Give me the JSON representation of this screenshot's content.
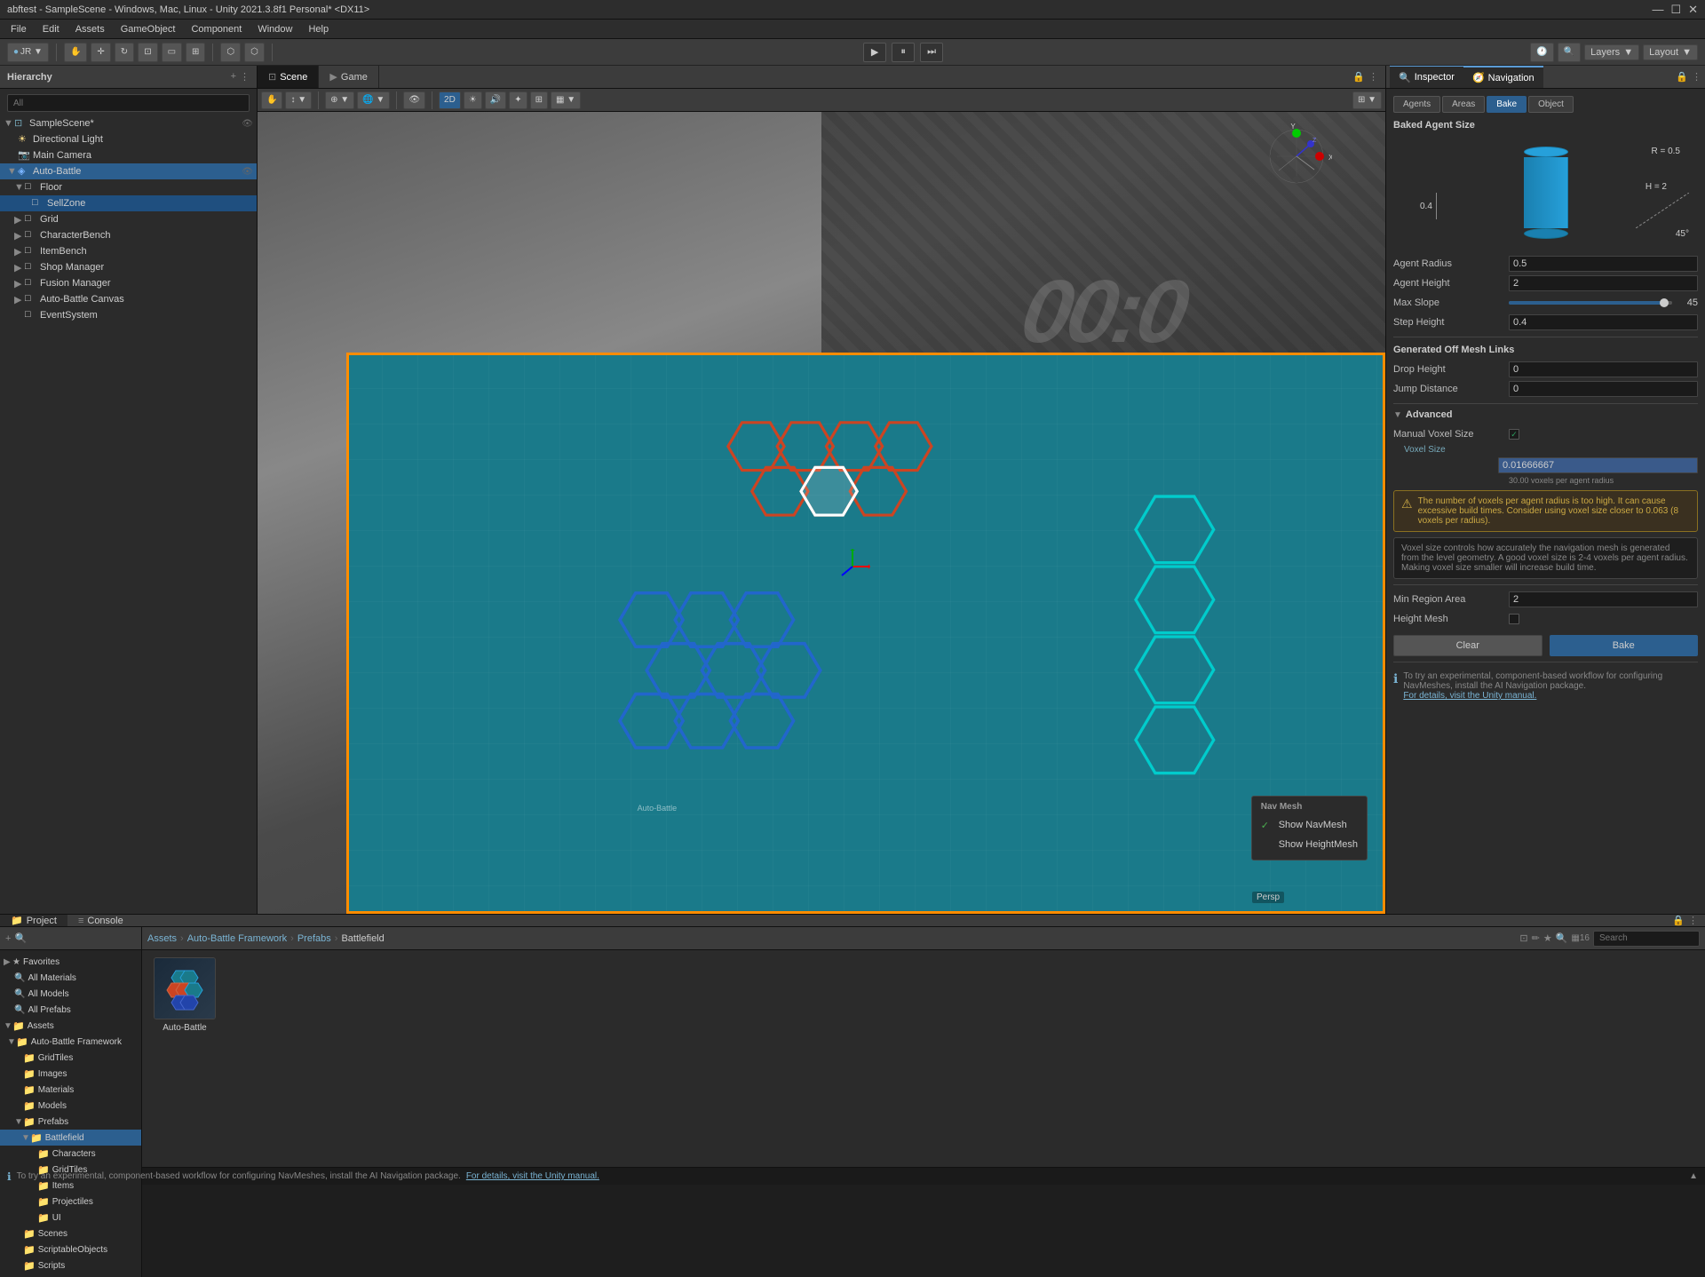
{
  "titlebar": {
    "title": "abftest - SampleScene - Windows, Mac, Linux - Unity 2021.3.8f1 Personal* <DX11>",
    "controls": [
      "—",
      "☐",
      "✕"
    ]
  },
  "menubar": {
    "items": [
      "File",
      "Edit",
      "Assets",
      "GameObject",
      "Component",
      "Window",
      "Help"
    ]
  },
  "toolbar": {
    "account": "JR ▼",
    "layers_label": "Layers",
    "layout_label": "Layout"
  },
  "hierarchy": {
    "title": "Hierarchy",
    "search_placeholder": "All",
    "items": [
      {
        "label": "SampleScene*",
        "indent": 0,
        "type": "scene",
        "arrow": "▼"
      },
      {
        "label": "Directional Light",
        "indent": 1,
        "type": "light",
        "arrow": ""
      },
      {
        "label": "Main Camera",
        "indent": 1,
        "type": "camera",
        "arrow": ""
      },
      {
        "label": "Auto-Battle",
        "indent": 1,
        "type": "prefab",
        "arrow": "▼",
        "selected": true
      },
      {
        "label": "Floor",
        "indent": 2,
        "type": "object",
        "arrow": "▼"
      },
      {
        "label": "SellZone",
        "indent": 3,
        "type": "object",
        "arrow": "",
        "highlighted": true
      },
      {
        "label": "Grid",
        "indent": 2,
        "type": "object",
        "arrow": "▶"
      },
      {
        "label": "CharacterBench",
        "indent": 2,
        "type": "object",
        "arrow": "▶"
      },
      {
        "label": "ItemBench",
        "indent": 2,
        "type": "object",
        "arrow": "▶"
      },
      {
        "label": "Shop Manager",
        "indent": 2,
        "type": "object",
        "arrow": "▶"
      },
      {
        "label": "Fusion Manager",
        "indent": 2,
        "type": "object",
        "arrow": "▶"
      },
      {
        "label": "Auto-Battle Canvas",
        "indent": 2,
        "type": "object",
        "arrow": "▶"
      },
      {
        "label": "EventSystem",
        "indent": 2,
        "type": "object",
        "arrow": ""
      }
    ]
  },
  "scene": {
    "tabs": [
      "Scene",
      "Game"
    ],
    "active_tab": "Scene"
  },
  "inspector": {
    "tab_inspector": "Inspector",
    "tab_navigation": "Navigation",
    "sub_tabs": [
      "Agents",
      "Areas",
      "Bake",
      "Object"
    ],
    "active_sub_tab": "Bake",
    "section_baked_agent": "Baked Agent Size",
    "agent_r_label": "R = 0.5",
    "agent_h_label": "H = 2",
    "agent_angle_label": "45°",
    "agent_left_val": "0.4",
    "rows": [
      {
        "label": "Agent Radius",
        "value": "0.5"
      },
      {
        "label": "Agent Height",
        "value": "2"
      },
      {
        "label": "Max Slope",
        "value": "45",
        "has_slider": true,
        "slider_pct": 95
      },
      {
        "label": "Step Height",
        "value": "0.4"
      }
    ],
    "section_off_mesh": "Generated Off Mesh Links",
    "off_mesh_rows": [
      {
        "label": "Drop Height",
        "value": "0"
      },
      {
        "label": "Jump Distance",
        "value": "0"
      }
    ],
    "section_advanced": "Advanced",
    "manual_voxel": {
      "label": "Manual Voxel Size",
      "checked": true
    },
    "voxel_size_label": "Voxel Size",
    "voxel_size_value": "0.01666667",
    "voxel_hint": "30.00 voxels per agent radius",
    "warning_text": "The number of voxels per agent radius is too high. It can cause excessive build times. Consider using voxel size closer to 0.063 (8 voxels per radius).",
    "info_text": "Voxel size controls how accurately the navigation mesh is generated from the level geometry. A good voxel size is 2-4 voxels per agent radius. Making voxel size smaller will increase build time.",
    "min_region_area_label": "Min Region Area",
    "min_region_area_value": "2",
    "height_mesh_label": "Height Mesh",
    "height_mesh_checked": false,
    "clear_btn": "Clear",
    "bake_btn": "Bake",
    "nav_info_text": "To try an experimental, component-based workflow for configuring NavMeshes, install the AI Navigation package.",
    "nav_link": "For details, visit the Unity manual."
  },
  "nav_popup": {
    "title": "Nav Mesh",
    "items": [
      {
        "label": "Show NavMesh",
        "checked": true
      },
      {
        "label": "Show HeightMesh",
        "checked": false
      }
    ]
  },
  "bottom": {
    "tabs": [
      "Project",
      "Console"
    ],
    "active_tab": "Project",
    "breadcrumb": [
      "Assets",
      "Auto-Battle Framework",
      "Prefabs",
      "Battlefield"
    ],
    "favorites": {
      "title": "Favorites",
      "items": [
        "All Materials",
        "All Models",
        "All Prefabs"
      ]
    },
    "assets_tree": [
      {
        "label": "Assets",
        "indent": 0,
        "arrow": "▼"
      },
      {
        "label": "Auto-Battle Framework",
        "indent": 1,
        "arrow": "▼"
      },
      {
        "label": "GridTiles",
        "indent": 2,
        "arrow": ""
      },
      {
        "label": "Images",
        "indent": 2,
        "arrow": ""
      },
      {
        "label": "Materials",
        "indent": 2,
        "arrow": ""
      },
      {
        "label": "Models",
        "indent": 2,
        "arrow": ""
      },
      {
        "label": "Prefabs",
        "indent": 2,
        "arrow": "▼"
      },
      {
        "label": "Battlefield",
        "indent": 3,
        "arrow": "▼",
        "selected": true
      },
      {
        "label": "Characters",
        "indent": 4,
        "arrow": ""
      },
      {
        "label": "GridTiles",
        "indent": 4,
        "arrow": ""
      },
      {
        "label": "Items",
        "indent": 4,
        "arrow": ""
      },
      {
        "label": "Projectiles",
        "indent": 4,
        "arrow": ""
      },
      {
        "label": "UI",
        "indent": 4,
        "arrow": ""
      },
      {
        "label": "Scenes",
        "indent": 2,
        "arrow": ""
      },
      {
        "label": "ScriptableObjects",
        "indent": 2,
        "arrow": ""
      },
      {
        "label": "Scripts",
        "indent": 2,
        "arrow": ""
      }
    ],
    "file_items": [
      {
        "name": "Auto-Battle",
        "type": "prefab"
      }
    ]
  },
  "status_bar": {
    "nav_info": "To try an experimental, component-based workflow for configuring NavMeshes, install the AI Navigation package.",
    "nav_link": "For details, visit the Unity manual."
  }
}
